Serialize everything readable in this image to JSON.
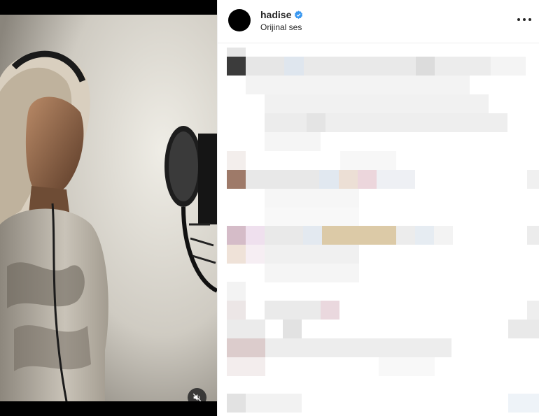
{
  "post": {
    "username": "hadise",
    "audio_label": "Orijinal ses",
    "verified": true
  },
  "icons": {
    "verified": "verified-badge-icon",
    "more": "more-options-icon",
    "mute": "speaker-muted-icon",
    "avatar": "profile-avatar"
  },
  "colors": {
    "verified_blue": "#3897f0",
    "text_primary": "#262626",
    "divider": "#efefef"
  },
  "comments_state": "pixelated"
}
